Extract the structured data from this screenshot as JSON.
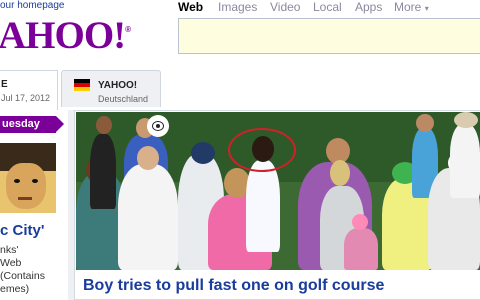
{
  "header": {
    "homepage_link": "our homepage",
    "logo_text": "AHOO!",
    "logo_mark": "®"
  },
  "nav": {
    "items": [
      "Web",
      "Images",
      "Video",
      "Local",
      "Apps",
      "More"
    ],
    "active_index": 0
  },
  "search": {
    "value": ""
  },
  "tabs": [
    {
      "title": "E",
      "subtitle": "Jul 17, 2012"
    },
    {
      "title": "YAHOO!",
      "subtitle": "Deutschland"
    }
  ],
  "sidebar_story": {
    "day_label": "uesday",
    "title": "c City'",
    "description_lines": [
      "nks'",
      "Web",
      "(Contains",
      "emes)"
    ]
  },
  "featured": {
    "headline": "Boy tries to pull fast one on golf course"
  },
  "colors": {
    "brand": "#7b0099",
    "link": "#1a3c9c",
    "search_bg": "#fffde0"
  }
}
